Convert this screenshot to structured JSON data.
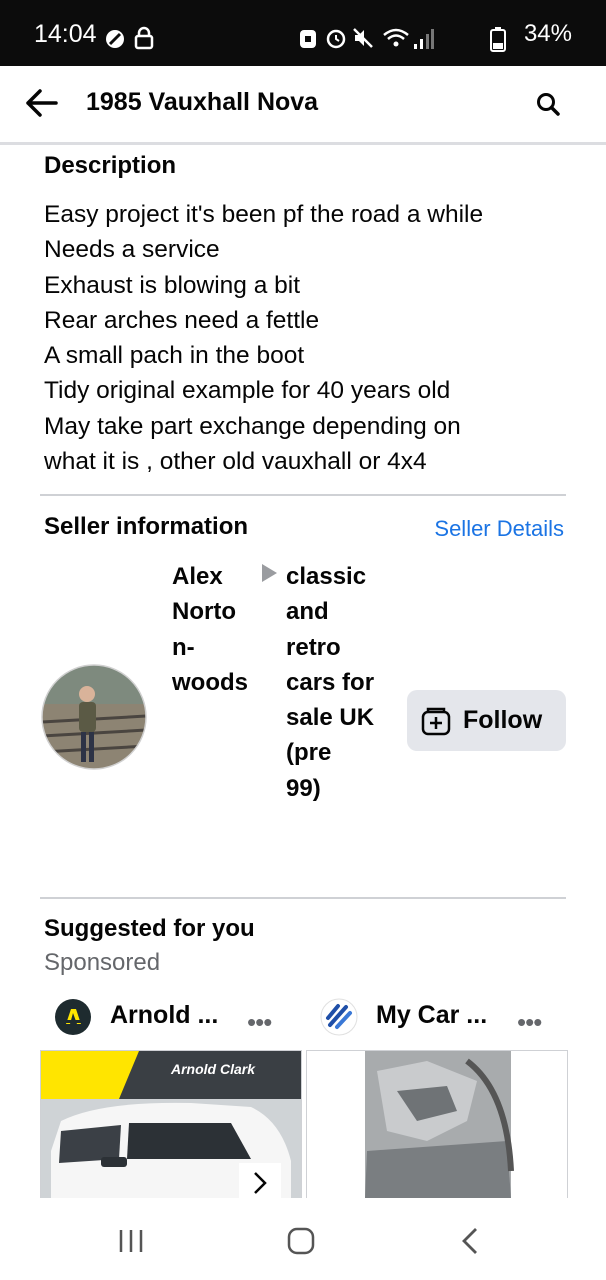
{
  "status_bar": {
    "time": "14:04",
    "battery": "34%",
    "icons": [
      "no-disturb-icon",
      "lock-icon",
      "battery-saver-icon",
      "alarm-icon",
      "mute-icon",
      "wifi-icon",
      "signal-icon",
      "battery-icon"
    ]
  },
  "app_bar": {
    "title": "1985 Vauxhall Nova",
    "back_icon": "arrow-left-icon",
    "search_icon": "search-icon"
  },
  "description": {
    "heading": "Description",
    "lines": [
      "Easy project it's been pf the road a while",
      "Needs a service",
      "Exhaust is blowing a bit",
      "Rear arches need a fettle",
      "A small pach in the boot",
      "Tidy original example for 40 years old",
      "May take part exchange  depending on",
      "what it is , other old vauxhall or 4x4"
    ]
  },
  "seller": {
    "heading": "Seller information",
    "details_link": "Seller Details",
    "name_lines": [
      "Alex",
      "Norto",
      "n-",
      "woods"
    ],
    "group_lines": [
      "classic",
      "and",
      "retro",
      "cars for",
      "sale UK",
      "(pre",
      "99)"
    ],
    "follow_label": "Follow"
  },
  "suggested": {
    "heading": "Suggested for you",
    "subheading": "Sponsored",
    "ads": [
      {
        "name": "Arnold ...",
        "banner_text": "Arnold Clark",
        "more": "•••"
      },
      {
        "name": "My Car ...",
        "more": "•••"
      }
    ]
  },
  "colors": {
    "link": "#1b74e4",
    "follow_bg": "#e4e6eb",
    "status_bg": "#0c0c0c",
    "arnold_yellow": "#ffe500"
  }
}
